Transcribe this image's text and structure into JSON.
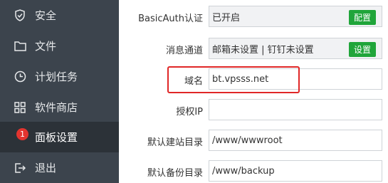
{
  "sidebar": {
    "items": [
      {
        "label": "安全",
        "icon": "shield-icon"
      },
      {
        "label": "文件",
        "icon": "folder-icon"
      },
      {
        "label": "计划任务",
        "icon": "clock-icon"
      },
      {
        "label": "软件商店",
        "icon": "grid-icon"
      },
      {
        "label": "面板设置",
        "icon": "gear-icon",
        "active": true,
        "badge": "1"
      },
      {
        "label": "退出",
        "icon": "logout-icon"
      }
    ]
  },
  "settings": {
    "basic_auth": {
      "label": "BasicAuth认证",
      "value": "已开启",
      "button": "配置"
    },
    "notify": {
      "label": "消息通道",
      "value": "邮箱未设置 | 钉钉未设置",
      "button": "设置"
    },
    "domain": {
      "label": "域名",
      "value": "bt.vpsss.net"
    },
    "auth_ip": {
      "label": "授权IP",
      "value": ""
    },
    "default_site_dir": {
      "label": "默认建站目录",
      "value": "/www/wwwroot"
    },
    "default_backup_dir": {
      "label": "默认备份目录",
      "value": "/www/backup"
    }
  },
  "colors": {
    "sidebar_bg": "#3c444d",
    "active_bg": "#2c3238",
    "accent_green": "#20a53a",
    "highlight_red": "#e02727"
  }
}
